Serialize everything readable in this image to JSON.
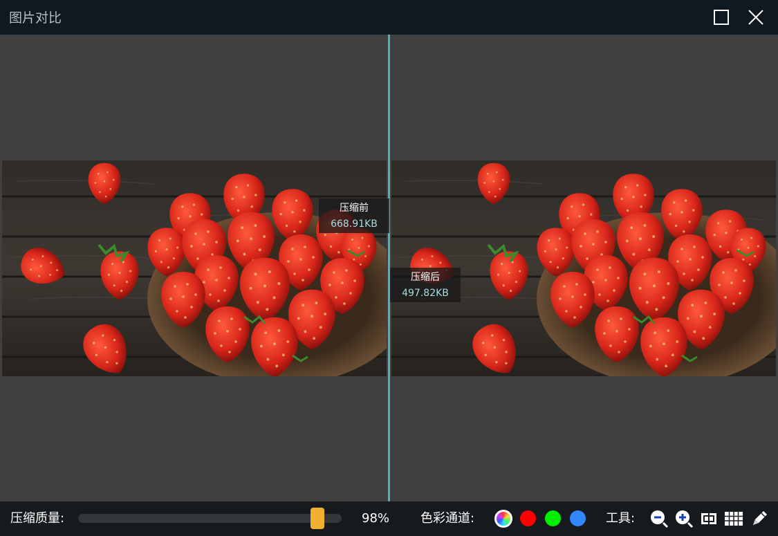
{
  "window": {
    "title": "图片对比"
  },
  "panels": {
    "before": {
      "label": "压缩前",
      "size": "668.91KB"
    },
    "after": {
      "label": "压缩后",
      "size": "497.82KB"
    }
  },
  "toolbar": {
    "quality_label": "压缩质量:",
    "quality_value": "98%",
    "quality_level": 0.93,
    "channel_label": "色彩通道:",
    "channels": [
      "all",
      "red",
      "green",
      "blue"
    ],
    "tools_label": "工具:",
    "tools": [
      "zoom-out-icon",
      "zoom-in-icon",
      "center-icon",
      "grid-icon",
      "pen-icon"
    ]
  },
  "colors": {
    "titlebar": "#101820",
    "canvas": "#404040",
    "divider": "#49b4bd",
    "slider_thumb": "#f0b030",
    "channel_red": "#ff0000",
    "channel_green": "#00ee00",
    "channel_blue": "#3388ff"
  }
}
